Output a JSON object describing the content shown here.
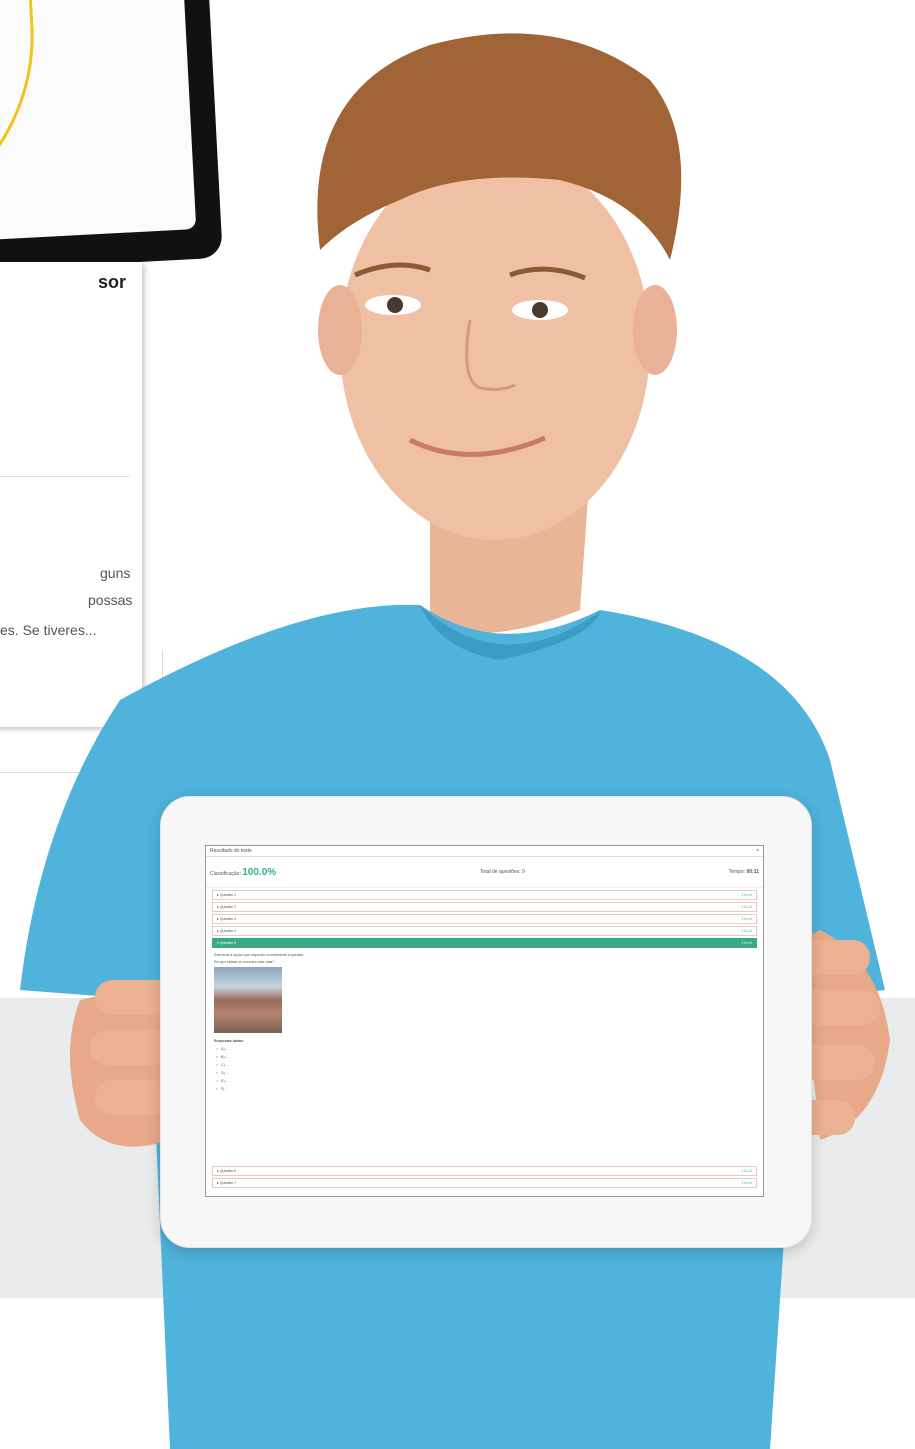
{
  "left_panel": {
    "title_fragment": "sor",
    "lines": [
      "guns",
      "possas",
      "es. Se tiveres..."
    ]
  },
  "tablet": {
    "header_title": "Resultado do teste",
    "close_icon": "close-icon",
    "stats": {
      "score_label": "Classificação:",
      "score_value": "100.0%",
      "questions_label": "Total de questões: 9",
      "time_label": "Tempo:",
      "time_value": "00:11"
    },
    "questions_top": [
      {
        "label": "Questão 1",
        "points": "1.0/1.0"
      },
      {
        "label": "Questão 2",
        "points": "1.0/1.0"
      },
      {
        "label": "Questão 3",
        "points": "1.0/1.0"
      },
      {
        "label": "Questão 4",
        "points": "1.0/1.0"
      },
      {
        "label": "Questão 5",
        "points": "1.0/1.0"
      }
    ],
    "active_body": {
      "intro": "Selecione a opção que responde corretamente à questão.",
      "prompt": "Em que cidade se encontra esta vista?",
      "options_title": "Respostas dadas:",
      "options": [
        "A) ...",
        "B) ...",
        "C) ...",
        "D) ...",
        "E) ...",
        "F) ..."
      ]
    },
    "questions_bottom": [
      {
        "label": "Questão 6",
        "points": "1.0/1.0"
      },
      {
        "label": "Questão 7",
        "points": "1.0/1.0"
      }
    ]
  },
  "colors": {
    "accent": "#2fb28c",
    "shirt": "#4fb3dc",
    "background_band": "#eaebec",
    "yellow_arc": "#f2c21b"
  }
}
